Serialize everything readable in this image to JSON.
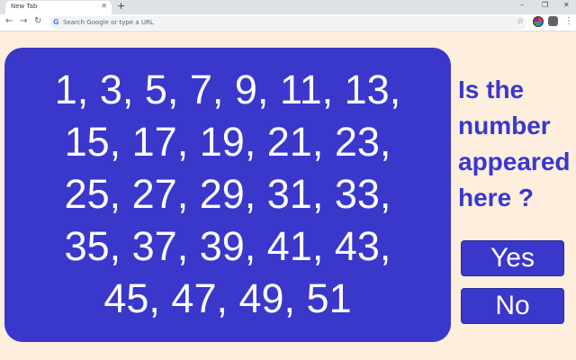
{
  "browser": {
    "tab_title": "New Tab",
    "tab_close": "✕",
    "new_tab": "+",
    "window_controls": {
      "minimize": "–",
      "restore": "❐",
      "close": "✕"
    },
    "nav": {
      "back": "←",
      "forward": "→",
      "reload": "↻"
    },
    "omnibox": {
      "placeholder": "Search Google or type a URL",
      "value": "",
      "g_icon": "G"
    },
    "star_icon": "☆",
    "menu_icon": "⋮"
  },
  "numbers": {
    "lines": [
      "1, 3, 5, 7, 9, 11, 13,",
      "15, 17, 19, 21, 23,",
      "25, 27, 29, 31, 33,",
      "35, 37, 39, 41, 43,",
      "45, 47, 49, 51"
    ]
  },
  "question": {
    "lines": [
      "Is the",
      "number",
      "appeared",
      "here ?"
    ]
  },
  "answers": {
    "yes": "Yes",
    "no": "No"
  },
  "colors": {
    "panel": "#3a37cb",
    "background": "#fdeedd",
    "text_on_panel": "#ffffff"
  }
}
